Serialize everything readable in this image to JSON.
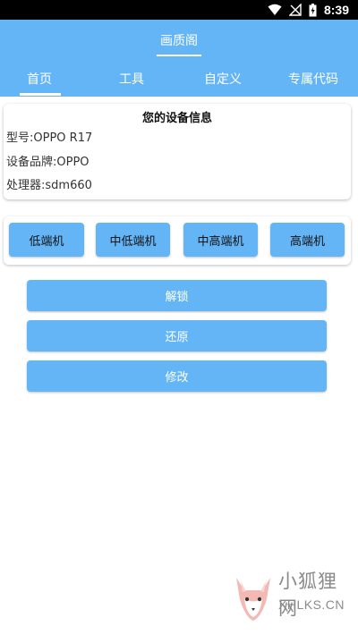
{
  "status_bar": {
    "time": "8:39",
    "icons": [
      "wifi-icon",
      "signal-muted-icon",
      "battery-icon"
    ]
  },
  "app_bar": {
    "title": "画质阁"
  },
  "tabs": [
    {
      "label": "首页",
      "active": true
    },
    {
      "label": "工具",
      "active": false
    },
    {
      "label": "自定义",
      "active": false
    },
    {
      "label": "专属代码",
      "active": false
    }
  ],
  "device_info": {
    "title": "您的设备信息",
    "model": "型号:OPPO R17",
    "brand": "设备品牌:OPPO",
    "processor": "处理器:sdm660"
  },
  "tier_buttons": [
    "低端机",
    "中低端机",
    "中高端机",
    "高端机"
  ],
  "action_buttons": [
    "解锁",
    "还原",
    "修改"
  ],
  "watermark": {
    "text": "小狐狸网",
    "sub": "XHLKS.CN"
  },
  "colors": {
    "primary": "#64b5f6",
    "status_bar": "#000000",
    "background": "#ffffff"
  }
}
